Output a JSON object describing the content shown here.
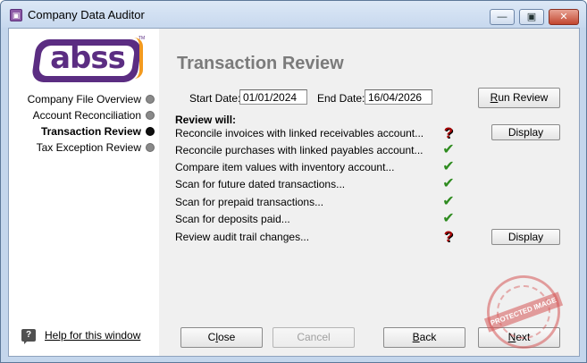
{
  "window": {
    "title": "Company Data Auditor",
    "app_icon_glyph": "▣",
    "minimize_glyph": "—",
    "maximize_glyph": "▣",
    "close_glyph": "✕"
  },
  "logo": {
    "text": "abss",
    "tm": "TM"
  },
  "nav": {
    "items": [
      {
        "label": "Company File Overview",
        "active": false
      },
      {
        "label": "Account Reconciliation",
        "active": false
      },
      {
        "label": "Transaction Review",
        "active": true
      },
      {
        "label": "Tax Exception Review",
        "active": false
      }
    ]
  },
  "help": {
    "icon": "help-speech-bubble-icon",
    "icon_glyph": "?",
    "label": "Help for this window"
  },
  "main": {
    "heading": "Transaction Review",
    "start_date_label": "Start Date:",
    "start_date": "01/01/2024",
    "end_date_label": "End Date:",
    "end_date": "16/04/2026",
    "run_review_label": "Run Review",
    "review_will_label": "Review will:",
    "checks": [
      {
        "text": "Reconcile invoices with linked receivables account...",
        "status": "question",
        "glyph": "?",
        "has_display": true
      },
      {
        "text": "Reconcile purchases with linked payables account...",
        "status": "check",
        "glyph": "✔",
        "has_display": false
      },
      {
        "text": "Compare item values with inventory account...",
        "status": "check",
        "glyph": "✔",
        "has_display": false
      },
      {
        "text": "Scan for future dated transactions...",
        "status": "check",
        "glyph": "✔",
        "has_display": false
      },
      {
        "text": "Scan for prepaid transactions...",
        "status": "check",
        "glyph": "✔",
        "has_display": false
      },
      {
        "text": "Scan for deposits paid...",
        "status": "check",
        "glyph": "✔",
        "has_display": false
      },
      {
        "text": "Review audit trail changes...",
        "status": "question",
        "glyph": "?",
        "has_display": true
      }
    ],
    "display_label": "Display"
  },
  "footer": {
    "close_label": "Close",
    "cancel_label": "Cancel",
    "back_label": "Back",
    "next_label": "Next"
  },
  "watermark": {
    "text": "PROTECTED IMAGE"
  },
  "colors": {
    "title_bar": "#c7d8ee",
    "check_green": "#2e8b1f",
    "question_red": "#a40000",
    "logo_purple": "#5b2d82",
    "logo_orange": "#f39a1f"
  }
}
